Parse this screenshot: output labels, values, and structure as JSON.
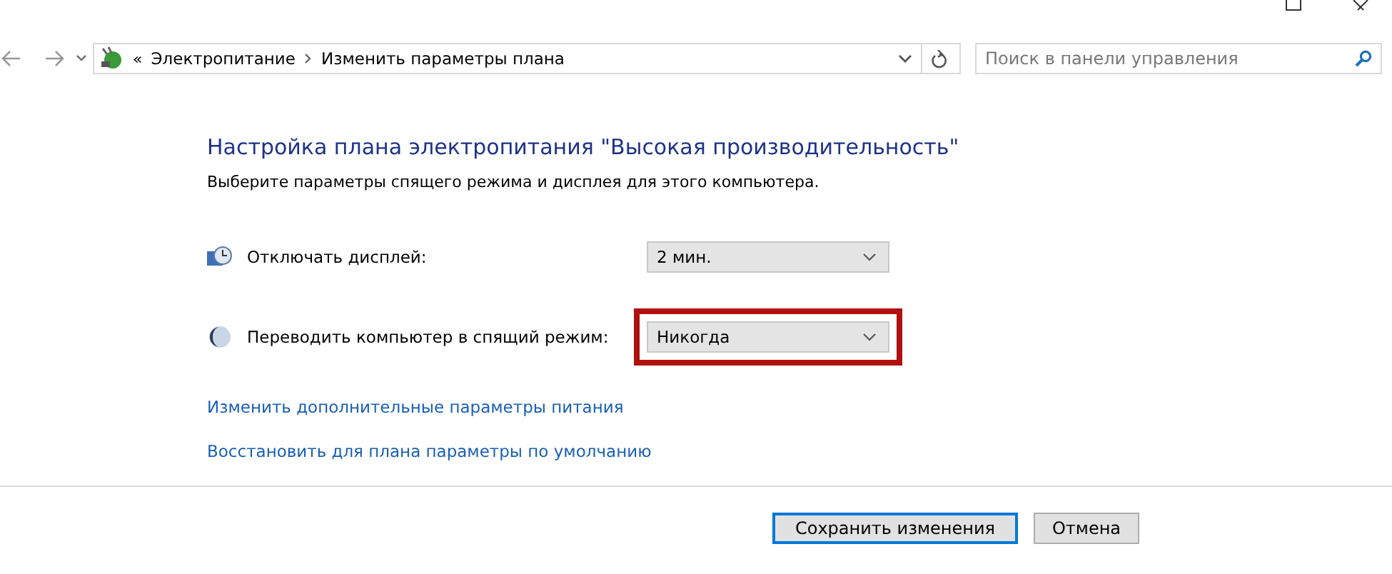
{
  "breadcrumb": {
    "prefix": "«",
    "items": [
      "Электропитание",
      "Изменить параметры плана"
    ]
  },
  "search": {
    "placeholder": "Поиск в панели управления"
  },
  "heading": "Настройка плана электропитания \"Высокая производительность\"",
  "subheading": "Выберите параметры спящего режима и дисплея для этого компьютера.",
  "settings": [
    {
      "kind": "display",
      "label": "Отключать дисплей:",
      "value": "2 мин.",
      "highlighted": false
    },
    {
      "kind": "sleep",
      "label": "Переводить компьютер в спящий режим:",
      "value": "Никогда",
      "highlighted": true
    }
  ],
  "links": [
    "Изменить дополнительные параметры питания",
    "Восстановить для плана параметры по умолчанию"
  ],
  "buttons": [
    {
      "label": "Сохранить изменения",
      "default": true
    },
    {
      "label": "Отмена",
      "default": false
    }
  ]
}
